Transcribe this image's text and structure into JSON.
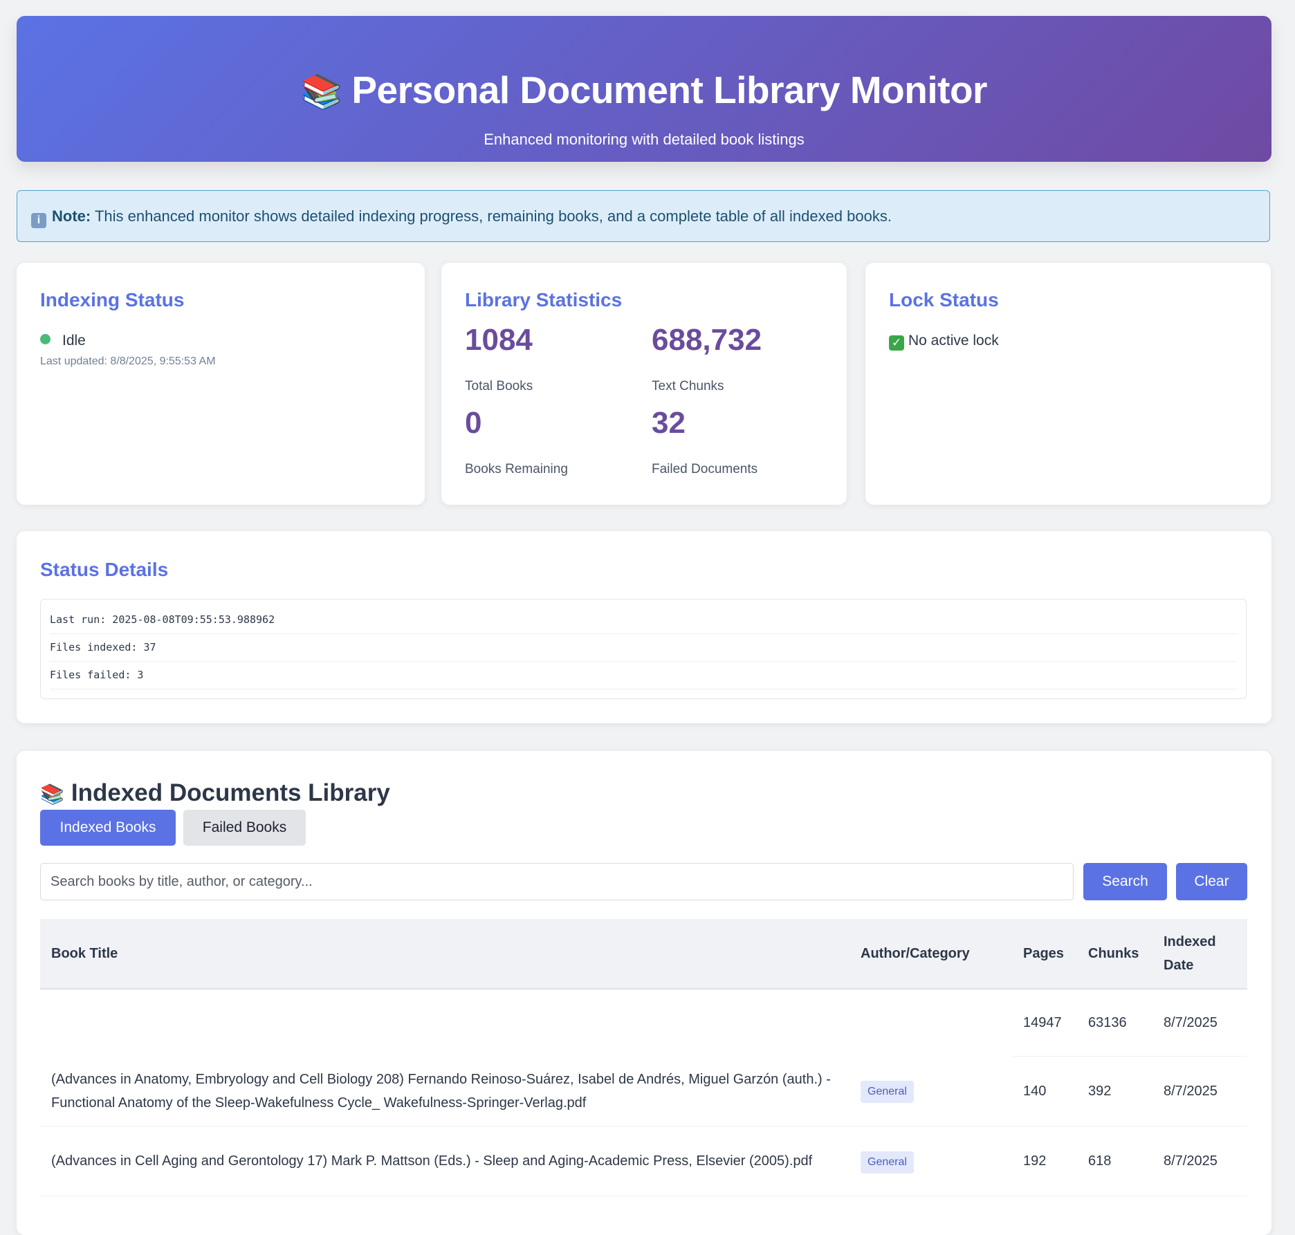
{
  "header": {
    "icon": "books-icon",
    "title": "Personal Document Library Monitor",
    "subtitle": "Enhanced monitoring with detailed book listings"
  },
  "note": {
    "icon": "info-icon",
    "label": "Note:",
    "text": "This enhanced monitor shows detailed indexing progress, remaining books, and a complete table of all indexed books."
  },
  "indexing": {
    "title": "Indexing Status",
    "state": "Idle",
    "state_color": "#48bb78",
    "last_updated": "Last updated: 8/8/2025, 9:55:53 AM"
  },
  "stats": {
    "title": "Library Statistics",
    "total_books": "1084",
    "total_books_label": "Total Books",
    "text_chunks": "688,732",
    "text_chunks_label": "Text Chunks",
    "books_remaining": "0",
    "books_remaining_label": "Books Remaining",
    "failed_docs": "32",
    "failed_docs_label": "Failed Documents"
  },
  "lock": {
    "title": "Lock Status",
    "icon": "check-icon",
    "text": "No active lock"
  },
  "details": {
    "title": "Status Details",
    "lines": [
      "Last run: 2025-08-08T09:55:53.988962",
      "Files indexed: 37",
      "Files failed: 3"
    ]
  },
  "library": {
    "icon": "books-icon",
    "title": "Indexed Documents Library",
    "tabs": [
      "Indexed Books",
      "Failed Books"
    ],
    "active_tab": "Indexed Books",
    "search_placeholder": "Search books by title, author, or category...",
    "search_value": "",
    "search_button": "Search",
    "clear_button": "Clear",
    "columns": [
      "Book Title",
      "Author/Category",
      "Pages",
      "Chunks",
      "Indexed Date"
    ],
    "rows": [
      {
        "title": "",
        "category": "",
        "pages": "14947",
        "chunks": "63136",
        "date": "8/7/2025"
      },
      {
        "title": "(Advances in Anatomy, Embryology and Cell Biology 208) Fernando Reinoso-Suárez, Isabel de Andrés, Miguel Garzón (auth.) - Functional Anatomy of the Sleep-Wakefulness Cycle_ Wakefulness-Springer-Verlag.pdf",
        "category": "General",
        "pages": "140",
        "chunks": "392",
        "date": "8/7/2025"
      },
      {
        "title": "(Advances in Cell Aging and Gerontology 17) Mark P. Mattson (Eds.) - Sleep and Aging-Academic Press, Elsevier (2005).pdf",
        "category": "General",
        "pages": "192",
        "chunks": "618",
        "date": "8/7/2025"
      }
    ]
  },
  "colors": {
    "accent": "#5b72e4",
    "stat_value": "#6a4c9c",
    "header_gradient_start": "#5b72e4",
    "header_gradient_end": "#6f4aa3",
    "note_bg": "#dcedf9"
  }
}
